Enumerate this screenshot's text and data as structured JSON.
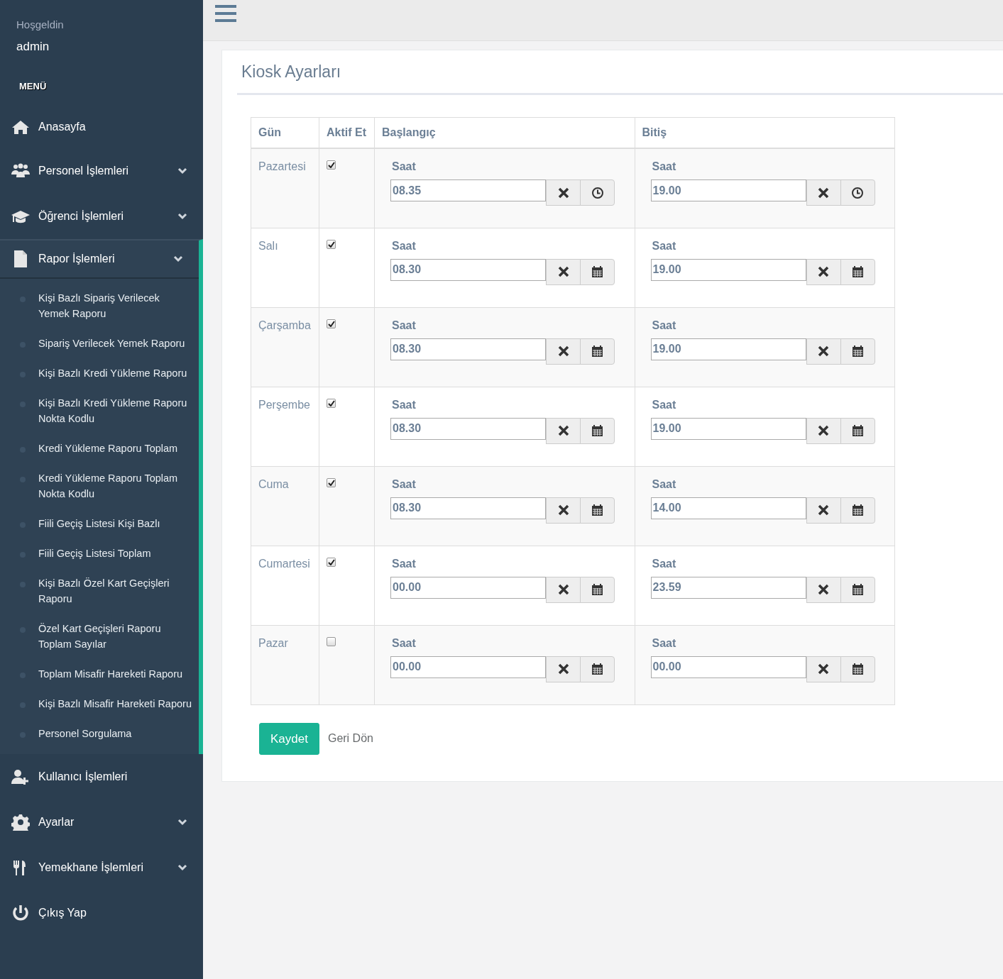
{
  "sidebar": {
    "greeting": "Hoşgeldin",
    "user": "admin",
    "menu_label": "MENÜ",
    "items": [
      {
        "label": "Anasayfa",
        "kind": "link",
        "expanded": false
      },
      {
        "label": "Personel İşlemleri",
        "kind": "group",
        "expanded": false
      },
      {
        "label": "Öğrenci İşlemleri",
        "kind": "group",
        "expanded": false
      },
      {
        "label": "Rapor İşlemleri",
        "kind": "group",
        "expanded": true,
        "children": [
          "Kişi Bazlı Sipariş Verilecek Yemek Raporu",
          "Sipariş Verilecek Yemek Raporu",
          "Kişi Bazlı Kredi Yükleme Raporu",
          "Kişi Bazlı Kredi Yükleme Raporu Nokta Kodlu",
          "Kredi Yükleme Raporu Toplam",
          "Kredi Yükleme Raporu Toplam Nokta Kodlu",
          "Fiili Geçiş Listesi Kişi Bazlı",
          "Fiili Geçiş Listesi Toplam",
          "Kişi Bazlı Özel Kart Geçişleri Raporu",
          "Özel Kart Geçişleri Raporu Toplam Sayılar",
          "Toplam Misafir Hareketi Raporu",
          "Kişi Bazlı Misafir Hareketi Raporu",
          "Personel Sorgulama"
        ]
      },
      {
        "label": "Kullanıcı İşlemleri",
        "kind": "link",
        "expanded": false
      },
      {
        "label": "Ayarlar",
        "kind": "group",
        "expanded": false
      },
      {
        "label": "Yemekhane İşlemleri",
        "kind": "group",
        "expanded": false
      },
      {
        "label": "Çıkış Yap",
        "kind": "link",
        "expanded": false
      }
    ]
  },
  "page": {
    "title": "Kiosk Ayarları"
  },
  "table": {
    "columns": [
      "Gün",
      "Aktif Et",
      "Başlangıç",
      "Bitiş"
    ],
    "rows": [
      {
        "day": "Pazartesi",
        "active": true,
        "start": {
          "label": "Saat",
          "value": "08.35",
          "kind": "clock"
        },
        "end": {
          "label": "Saat",
          "value": "19.00",
          "kind": "clock"
        }
      },
      {
        "day": "Salı",
        "active": true,
        "start": {
          "label": "Saat",
          "value": "08.30",
          "kind": "calendar"
        },
        "end": {
          "label": "Saat",
          "value": "19.00",
          "kind": "calendar"
        }
      },
      {
        "day": "Çarşamba",
        "active": true,
        "start": {
          "label": "Saat",
          "value": "08.30",
          "kind": "calendar"
        },
        "end": {
          "label": "Saat",
          "value": "19.00",
          "kind": "calendar"
        }
      },
      {
        "day": "Perşembe",
        "active": true,
        "start": {
          "label": "Saat",
          "value": "08.30",
          "kind": "calendar"
        },
        "end": {
          "label": "Saat",
          "value": "19.00",
          "kind": "calendar"
        }
      },
      {
        "day": "Cuma",
        "active": true,
        "start": {
          "label": "Saat",
          "value": "08.30",
          "kind": "calendar"
        },
        "end": {
          "label": "Saat",
          "value": "14.00",
          "kind": "calendar"
        }
      },
      {
        "day": "Cumartesi",
        "active": true,
        "start": {
          "label": "Saat",
          "value": "00.00",
          "kind": "calendar"
        },
        "end": {
          "label": "Saat",
          "value": "23.59",
          "kind": "calendar"
        }
      },
      {
        "day": "Pazar",
        "active": false,
        "start": {
          "label": "Saat",
          "value": "00.00",
          "kind": "calendar"
        },
        "end": {
          "label": "Saat",
          "value": "00.00",
          "kind": "calendar"
        }
      }
    ]
  },
  "buttons": {
    "save": "Kaydet",
    "back": "Geri Dön"
  }
}
